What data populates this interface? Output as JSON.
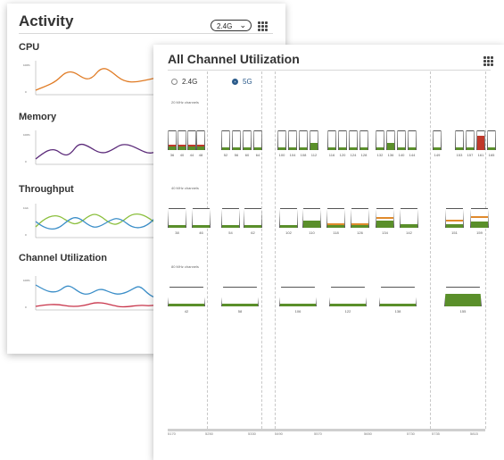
{
  "activity": {
    "title": "Activity",
    "band_select": "2.4G",
    "sections": [
      {
        "title": "CPU"
      },
      {
        "title": "Memory"
      },
      {
        "title": "Throughput"
      },
      {
        "title": "Channel Utilization"
      }
    ]
  },
  "channel_util": {
    "title": "All Channel Utilization",
    "radios": [
      {
        "label": "2.4G",
        "selected": false
      },
      {
        "label": "5G",
        "selected": true
      }
    ],
    "group_labels": [
      "20 MHz channels",
      "40 MHz channels",
      "80 MHz channels"
    ],
    "row20": [
      "36",
      "40",
      "44",
      "48",
      "52",
      "56",
      "60",
      "64",
      "100",
      "104",
      "108",
      "112",
      "116",
      "120",
      "124",
      "128",
      "132",
      "136",
      "140",
      "144",
      "149",
      "153",
      "157",
      "161",
      "165"
    ],
    "row40": [
      "38",
      "46",
      "54",
      "62",
      "102",
      "110",
      "118",
      "126",
      "134",
      "142",
      "151",
      "159"
    ],
    "row80": [
      "42",
      "58",
      "106",
      "122",
      "138",
      "155"
    ],
    "axis_ticks": [
      "5170",
      "5250",
      "5330",
      "5490",
      "5570",
      "5650",
      "5730",
      "5735",
      "5815"
    ],
    "colors": {
      "green": "#5a8f2a",
      "orange": "#e08a2c",
      "red": "#c0392b"
    }
  }
}
